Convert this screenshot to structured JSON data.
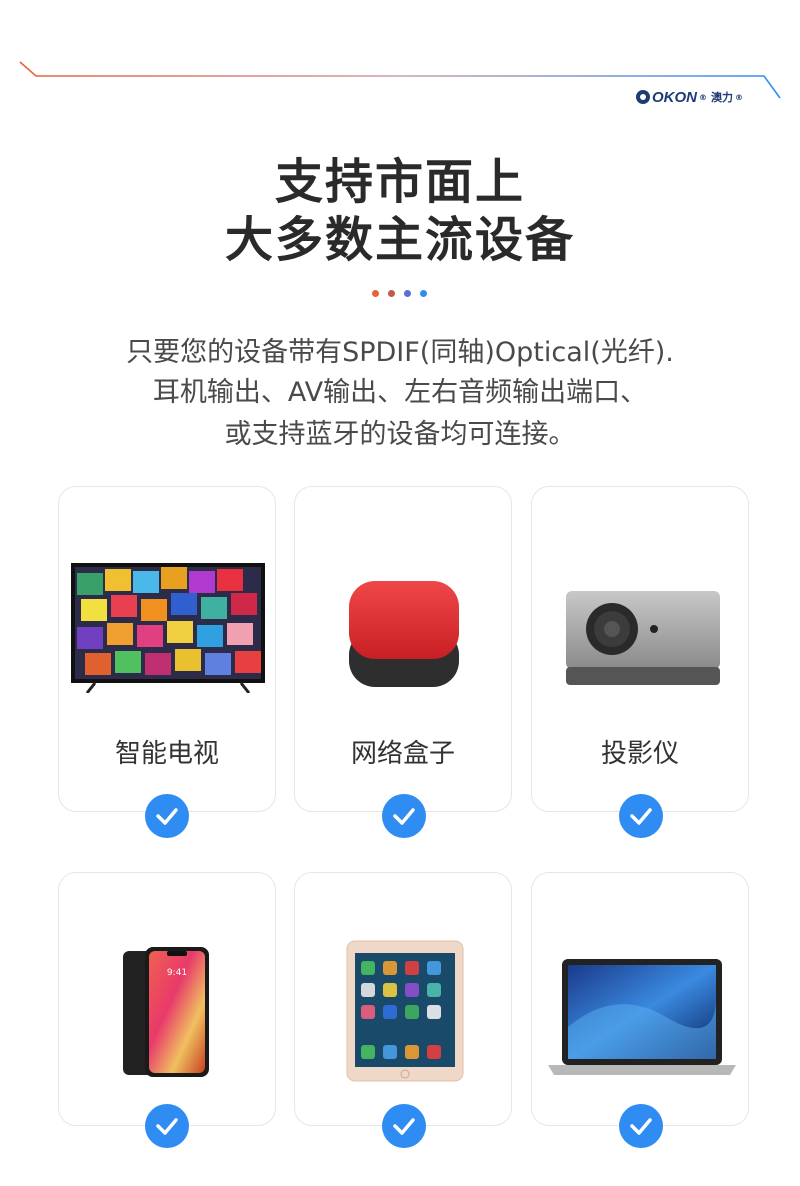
{
  "brand": {
    "name": "OKON",
    "registered": "®",
    "chinese": "澳力",
    "registered2": "®"
  },
  "title": {
    "line1": "支持市面上",
    "line2": "大多数主流设备"
  },
  "description": {
    "line1": "只要您的设备带有SPDIF(同轴)Optical(光纤).",
    "line2": "耳机输出、AV输出、左右音频输出端口、",
    "line3": "或支持蓝牙的设备均可连接。"
  },
  "colors": {
    "accent_blue": "#2f8cf3",
    "dot1": "#e8603c",
    "dot2": "#c05a4a",
    "dot3": "#5a6fd0",
    "dot4": "#2f8cf3"
  },
  "devices": [
    {
      "label": "智能电视",
      "icon": "tv-icon"
    },
    {
      "label": "网络盒子",
      "icon": "tv-box-icon"
    },
    {
      "label": "投影仪",
      "icon": "projector-icon"
    },
    {
      "label": "",
      "icon": "phone-icon"
    },
    {
      "label": "",
      "icon": "tablet-icon"
    },
    {
      "label": "",
      "icon": "laptop-icon"
    }
  ]
}
